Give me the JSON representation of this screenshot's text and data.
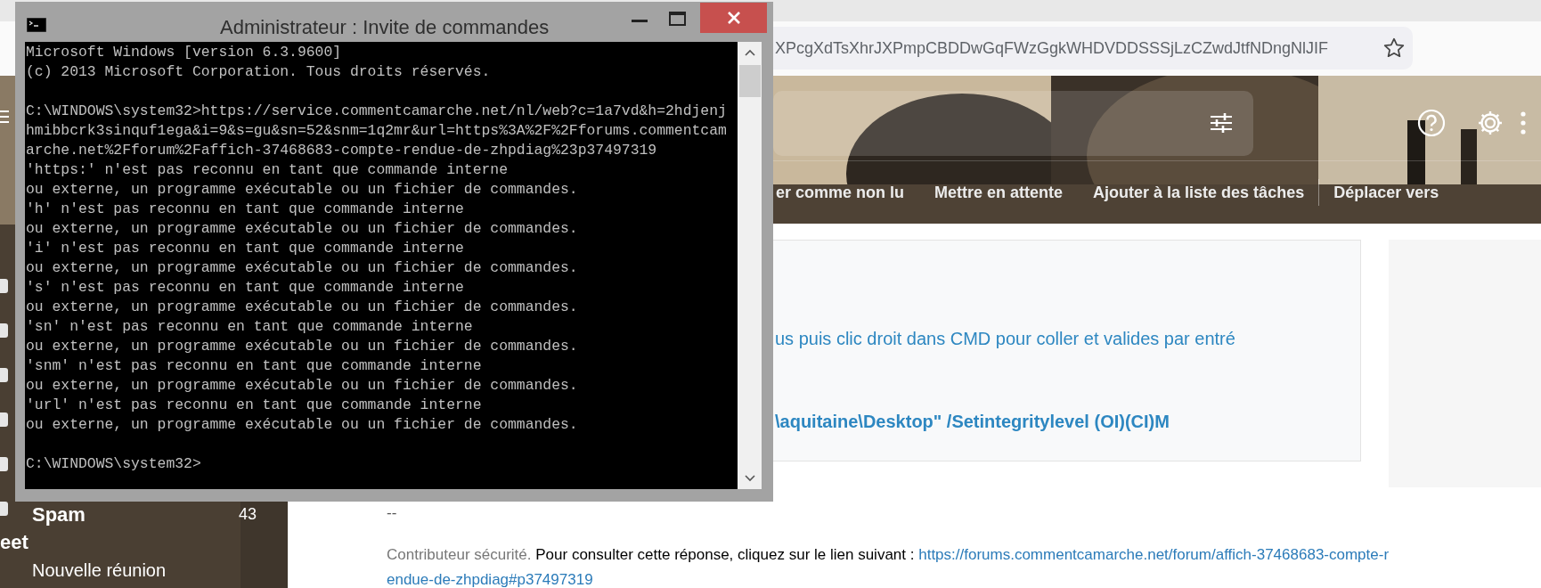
{
  "browser": {
    "url": "XPcgXdTsXhrJXPmpCBDDwGqFWzGgkWHDVDDSSSjLzCZwdJtfNDngNlJIF"
  },
  "header": {
    "toolbar_groups": [
      [
        "er comme non lu",
        "Mettre en attente",
        "Ajouter à la liste des tâches"
      ],
      [
        "Déplacer vers"
      ]
    ]
  },
  "sidebar": {
    "items": [
      {
        "kind": "label",
        "label": "Spam",
        "count": "43"
      },
      {
        "kind": "section",
        "label": "eet"
      },
      {
        "kind": "item",
        "label": "Nouvelle réunion"
      }
    ]
  },
  "message": {
    "lines": [
      {
        "kind": "plain",
        "text": "us puis clic droit dans CMD pour coller et valides par entré"
      },
      {
        "kind": "bold",
        "text": "\\aquitaine\\Desktop\" /Setintegritylevel (OI)(CI)M"
      }
    ],
    "signature": "--",
    "footer": {
      "role": "Contributeur sécurité.",
      "text": "Pour consulter cette réponse, cliquez sur le lien suivant :",
      "link_lines": [
        "https://forums.commentcamarche.net/forum/affich-37468683-compte-r",
        "endue-de-zhpdiag#p37497319"
      ]
    }
  },
  "console": {
    "title": "Administrateur : Invite de commandes",
    "blocks": [
      [
        "Microsoft Windows [version 6.3.9600]",
        "(c) 2013 Microsoft Corporation. Tous droits réservés."
      ],
      [
        "C:\\WINDOWS\\system32>https://service.commentcamarche.net/nl/web?c=1a7vd&h=2hdjenj",
        "hmibbcrk3sinquf1ega&i=9&s=gu&sn=52&snm=1q2mr&url=https%3A%2F%2Fforums.commentcam",
        "arche.net%2Fforum%2Faffich-37468683-compte-rendue-de-zhpdiag%23p37497319",
        "'https:' n'est pas reconnu en tant que commande interne",
        "ou externe, un programme exécutable ou un fichier de commandes.",
        "'h' n'est pas reconnu en tant que commande interne",
        "ou externe, un programme exécutable ou un fichier de commandes.",
        "'i' n'est pas reconnu en tant que commande interne",
        "ou externe, un programme exécutable ou un fichier de commandes.",
        "'s' n'est pas reconnu en tant que commande interne",
        "ou externe, un programme exécutable ou un fichier de commandes.",
        "'sn' n'est pas reconnu en tant que commande interne",
        "ou externe, un programme exécutable ou un fichier de commandes.",
        "'snm' n'est pas reconnu en tant que commande interne",
        "ou externe, un programme exécutable ou un fichier de commandes.",
        "'url' n'est pas reconnu en tant que commande interne",
        "ou externe, un programme exécutable ou un fichier de commandes."
      ],
      [
        "C:\\WINDOWS\\system32>"
      ]
    ]
  }
}
